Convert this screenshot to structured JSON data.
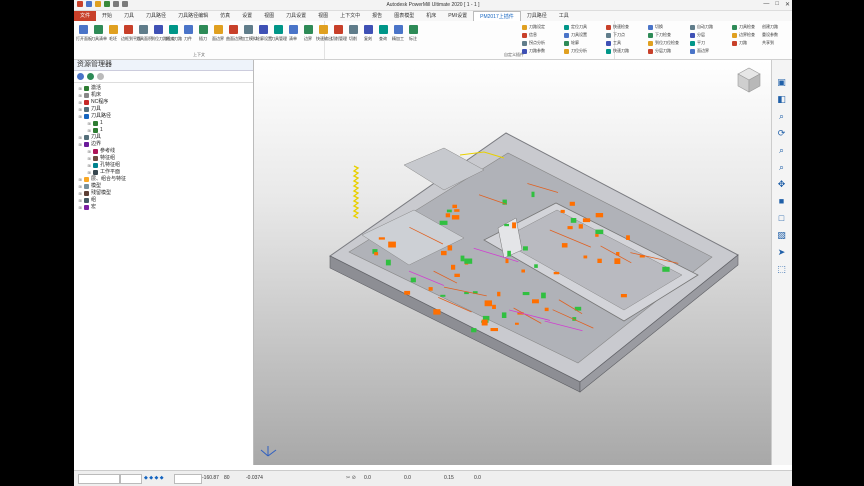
{
  "window": {
    "title": "Autodesk PowerMill Ultimate 2020  [ 1 - 1 ]",
    "controls": [
      "—",
      "□",
      "✕"
    ]
  },
  "tabs": [
    "文件",
    "开始",
    "刀具",
    "刀具路径",
    "刀具路径编辑",
    "仿真",
    "设置",
    "视图",
    "刀具设置",
    "视图",
    "上下文中",
    "报告",
    "图表模型",
    "机床",
    "PMI设置",
    "PM2017上插件",
    "刀具路径",
    "工具"
  ],
  "active_tab_index": 15,
  "ribbon": {
    "big_buttons": [
      "打开面板",
      "刀具清单",
      "毛坯",
      "边框到平面",
      "刀具面积",
      "到位刀路检查",
      "插入刀路",
      "刀件",
      "插刀",
      "面边界",
      "曲面边界",
      "加工模拟",
      "轮廓设置",
      "刀具管理",
      "清单",
      "边界",
      "快速输出",
      "切削管理",
      "切削",
      "复刻",
      "查询",
      "精加工",
      "标注"
    ],
    "group_labels": [
      "上下文",
      "自定义插件"
    ],
    "small_buttons": [
      "刀路设定",
      "信息",
      "拐点分析",
      "刀路参数",
      "定位刀具",
      "刀具设置",
      "轮廓",
      "刀位分析",
      "快速检查",
      "下刀点",
      "工具",
      "快速刀路",
      "切换",
      "下刀检查",
      "到位刀位检查",
      "分层刀路",
      "自动刀路",
      "分层",
      "平刀",
      "面边界",
      "刀具检查",
      "边界检查",
      "刀路"
    ],
    "right_links": [
      "创建刀路",
      "重设参数",
      "共享到"
    ]
  },
  "explorer": {
    "title": "资源管理器",
    "tree": [
      {
        "label": "激活",
        "depth": 0,
        "color": "#2e7d32"
      },
      {
        "label": "机床",
        "depth": 0,
        "color": "#888888"
      },
      {
        "label": "NC程序",
        "depth": 0,
        "color": "#c62828"
      },
      {
        "label": "刀具",
        "depth": 0,
        "color": "#546e7a"
      },
      {
        "label": "刀具路径",
        "depth": 0,
        "color": "#1565c0"
      },
      {
        "label": "1",
        "depth": 1,
        "color": "#2e7d32"
      },
      {
        "label": "1",
        "depth": 1,
        "color": "#2e7d32"
      },
      {
        "label": "刀具",
        "depth": 0,
        "color": "#546e7a"
      },
      {
        "label": "边界",
        "depth": 0,
        "color": "#6a1b9a"
      },
      {
        "label": "参考线",
        "depth": 1,
        "color": "#ad1457"
      },
      {
        "label": "特征组",
        "depth": 1,
        "color": "#6d4c41"
      },
      {
        "label": "孔特征组",
        "depth": 1,
        "color": "#00838f"
      },
      {
        "label": "工作平面",
        "depth": 1,
        "color": "#37474f"
      },
      {
        "label": "层、组合与特征",
        "depth": 0,
        "color": "#f9a825"
      },
      {
        "label": "模型",
        "depth": 0,
        "color": "#78909c"
      },
      {
        "label": "残留模型",
        "depth": 0,
        "color": "#5d4037"
      },
      {
        "label": "组",
        "depth": 0,
        "color": "#455a64"
      },
      {
        "label": "宏",
        "depth": 0,
        "color": "#7b1fa2"
      }
    ]
  },
  "status": {
    "x": "-160.87",
    "y": "80",
    "z": "-0.0374",
    "tol1": "0.0",
    "tol2": "0.0",
    "tol3": "0.15",
    "tol4": "0.0"
  },
  "colors": {
    "accent": "#1565c0",
    "file_tab": "#c8402a",
    "part": "#c4c6cc",
    "green": "#30c040",
    "orange": "#ff6f00"
  }
}
